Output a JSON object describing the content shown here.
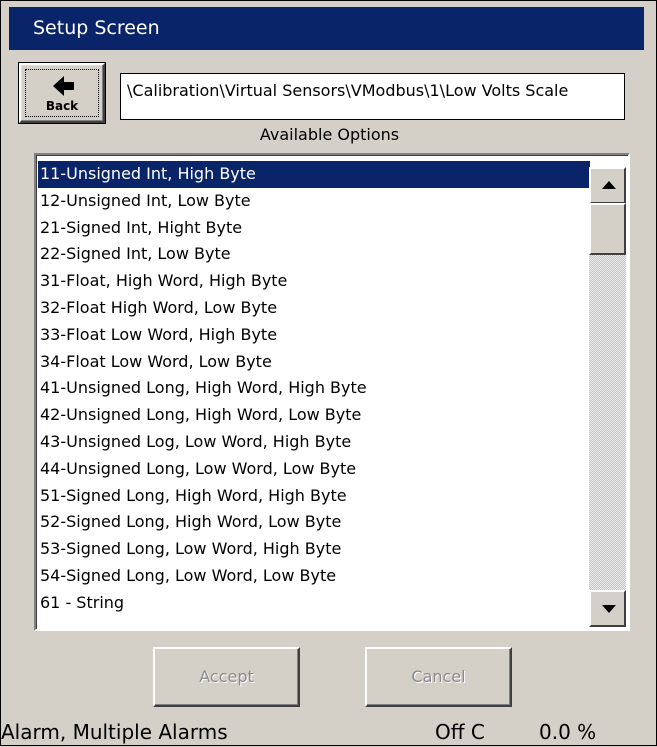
{
  "window": {
    "title": "Setup Screen"
  },
  "toolbar": {
    "back_label": "Back"
  },
  "path": {
    "value": "\\Calibration\\Virtual Sensors\\VModbus\\1\\Low Volts Scale"
  },
  "options": {
    "caption": "Available Options",
    "selected_index": 0,
    "items": [
      "11-Unsigned Int, High Byte",
      "12-Unsigned Int, Low Byte",
      "21-Signed Int, Hight Byte",
      "22-Signed Int, Low Byte",
      "31-Float, High Word, High Byte",
      "32-Float High Word, Low Byte",
      "33-Float Low Word, High Byte",
      "34-Float Low Word, Low Byte",
      "41-Unsigned Long, High Word, High Byte",
      "42-Unsigned Long, High Word, Low Byte",
      "43-Unsigned Log, Low Word, High Byte",
      "44-Unsigned Long, Low Word, Low Byte",
      "51-Signed Long, High Word, High Byte",
      "52-Signed Long, High Word, Low Byte",
      "53-Signed Long, Low Word, High Byte",
      "54-Signed Long, Low Word, Low Byte",
      "61 - String"
    ]
  },
  "actions": {
    "accept_label": "Accept",
    "cancel_label": "Cancel"
  },
  "status": {
    "alarm": "Alarm, Multiple Alarms",
    "state": "Off C",
    "value": "0.0 %"
  },
  "colors": {
    "title_bg": "#0a246a",
    "selection_bg": "#0a246a",
    "face": "#d4d0c8"
  },
  "icons": {
    "back": "left-arrow-icon",
    "scroll_up": "scroll-up-arrow-icon",
    "scroll_down": "scroll-down-arrow-icon"
  }
}
